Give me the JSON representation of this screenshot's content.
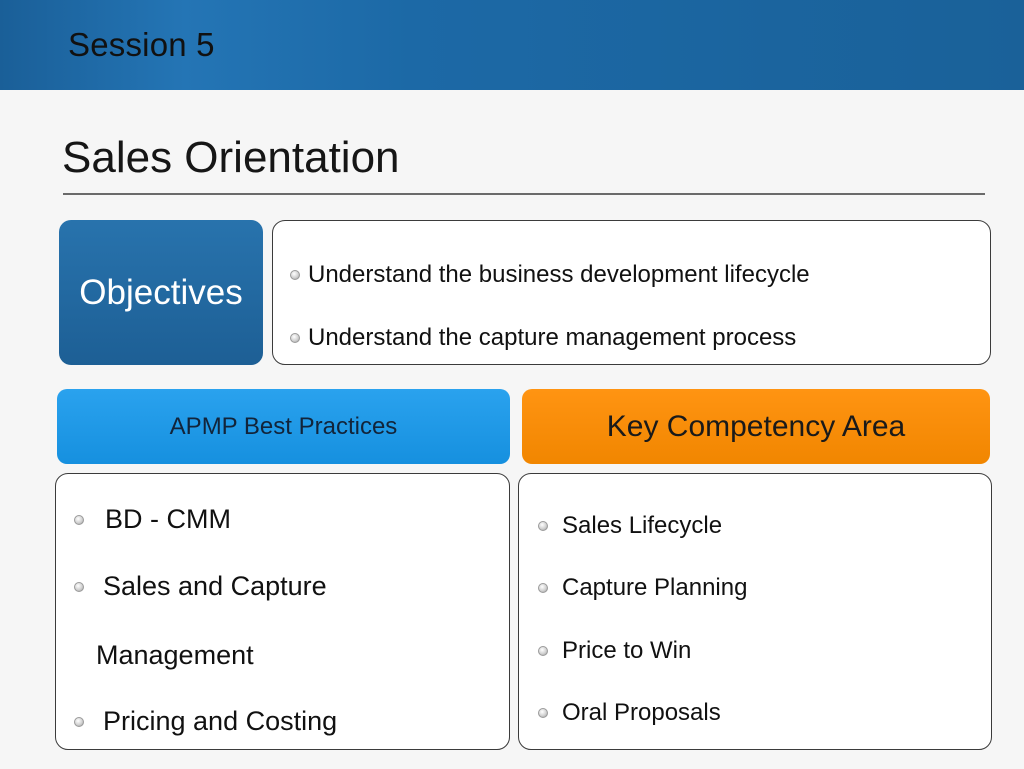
{
  "header": {
    "session": "Session 5"
  },
  "title": "Sales Orientation",
  "objectives": {
    "label": "Objectives",
    "items": [
      "Understand the business development lifecycle",
      "Understand the capture management process"
    ]
  },
  "apmp": {
    "heading": "APMP Best Practices",
    "items": [
      "BD - CMM",
      "Sales and Capture",
      "Management",
      "Pricing and Costing"
    ]
  },
  "kca": {
    "heading": "Key Competency Area",
    "items": [
      "Sales Lifecycle",
      "Capture Planning",
      "Price to Win",
      "Oral Proposals"
    ]
  },
  "colors": {
    "header_blue": "#1c69a6",
    "objectives_blue": "#1d5f95",
    "apmp_blue": "#1690df",
    "kca_orange": "#f18600"
  }
}
